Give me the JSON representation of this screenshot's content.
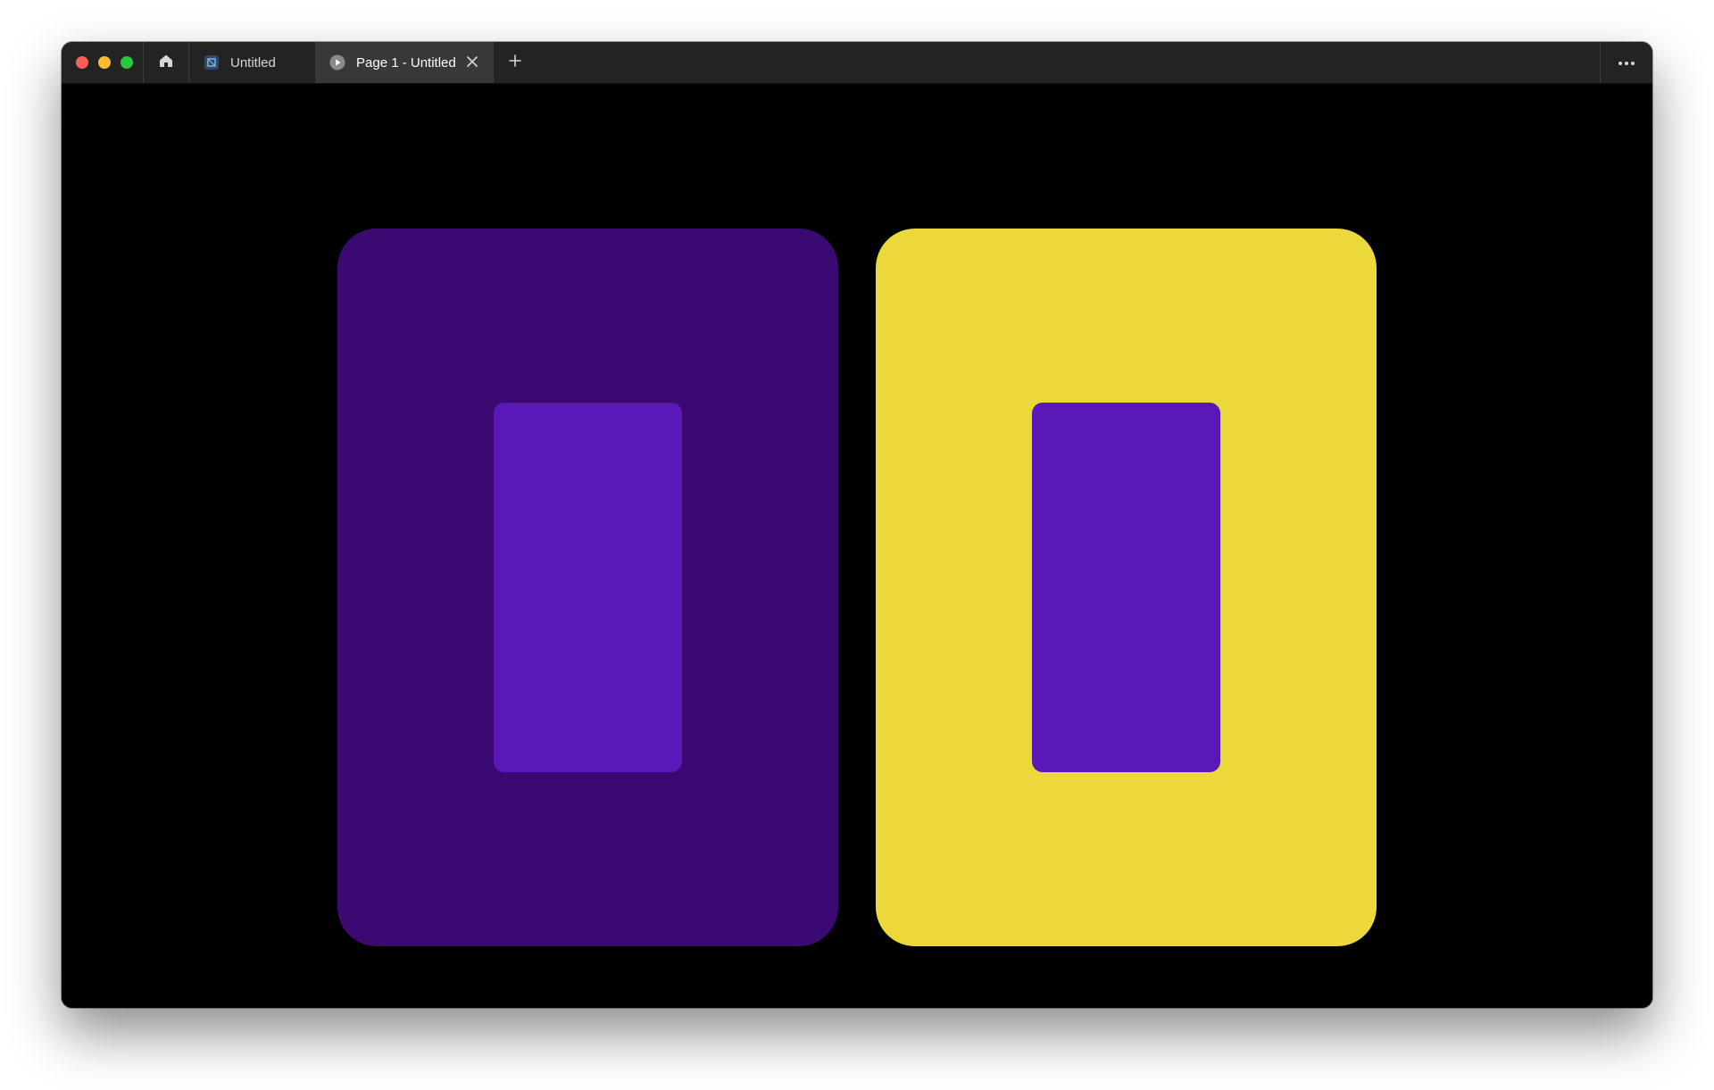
{
  "window": {
    "tabs": [
      {
        "label": "Untitled",
        "icon": "figma-file-icon",
        "active": false
      },
      {
        "label": "Page 1 - Untitled",
        "icon": "play-icon",
        "active": true
      }
    ]
  },
  "colors": {
    "card_left_bg": "#3a0a72",
    "card_left_inner": "#5b18b8",
    "card_right_bg": "#ebd93c",
    "card_right_inner": "#5b18b8",
    "titlebar": "#232323",
    "active_tab": "#383838"
  },
  "icons": {
    "home": "home-icon",
    "close": "close-icon",
    "add": "plus-icon",
    "more": "more-horizontal-icon"
  }
}
